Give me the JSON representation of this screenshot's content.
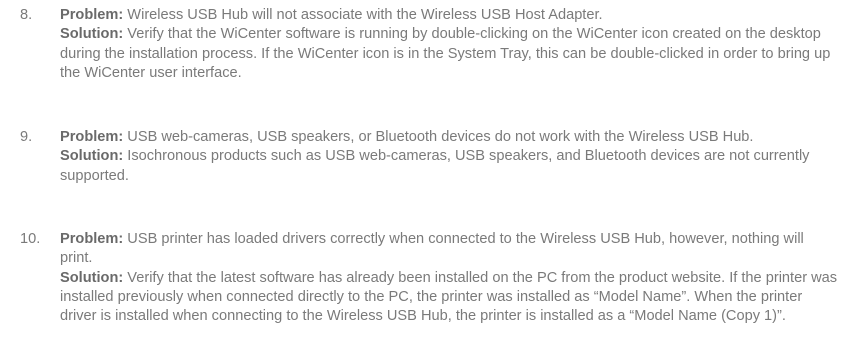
{
  "items": [
    {
      "number": "8.",
      "problem_label": "Problem:",
      "problem_text": " Wireless USB Hub will not associate with the Wireless USB Host Adapter.",
      "solution_label": "Solution:",
      "solution_text": " Verify that the WiCenter software is running by double-clicking on the WiCenter icon created on the desktop during the installation process. If the WiCenter icon is in the System Tray, this can be double-clicked in order to bring up the WiCenter user interface."
    },
    {
      "number": "9.",
      "problem_label": "Problem:",
      "problem_text": " USB web-cameras, USB speakers, or Bluetooth devices do not work with the Wireless USB Hub.",
      "solution_label": "Solution:",
      "solution_text": " Isochronous products such as USB web-cameras, USB speakers, and Bluetooth devices are not currently supported."
    },
    {
      "number": "10.",
      "problem_label": "Problem:",
      "problem_text": " USB printer has loaded drivers correctly when connected to the Wireless USB Hub, however, nothing will print.",
      "solution_label": "Solution:",
      "solution_text": " Verify that the latest software has already been installed on the PC from the product website. If the printer was installed previously when connected directly to the PC, the printer was installed as “Model Name”. When the printer driver is installed when connecting to the Wireless USB Hub, the printer is installed as a “Model Name (Copy 1)”."
    }
  ]
}
